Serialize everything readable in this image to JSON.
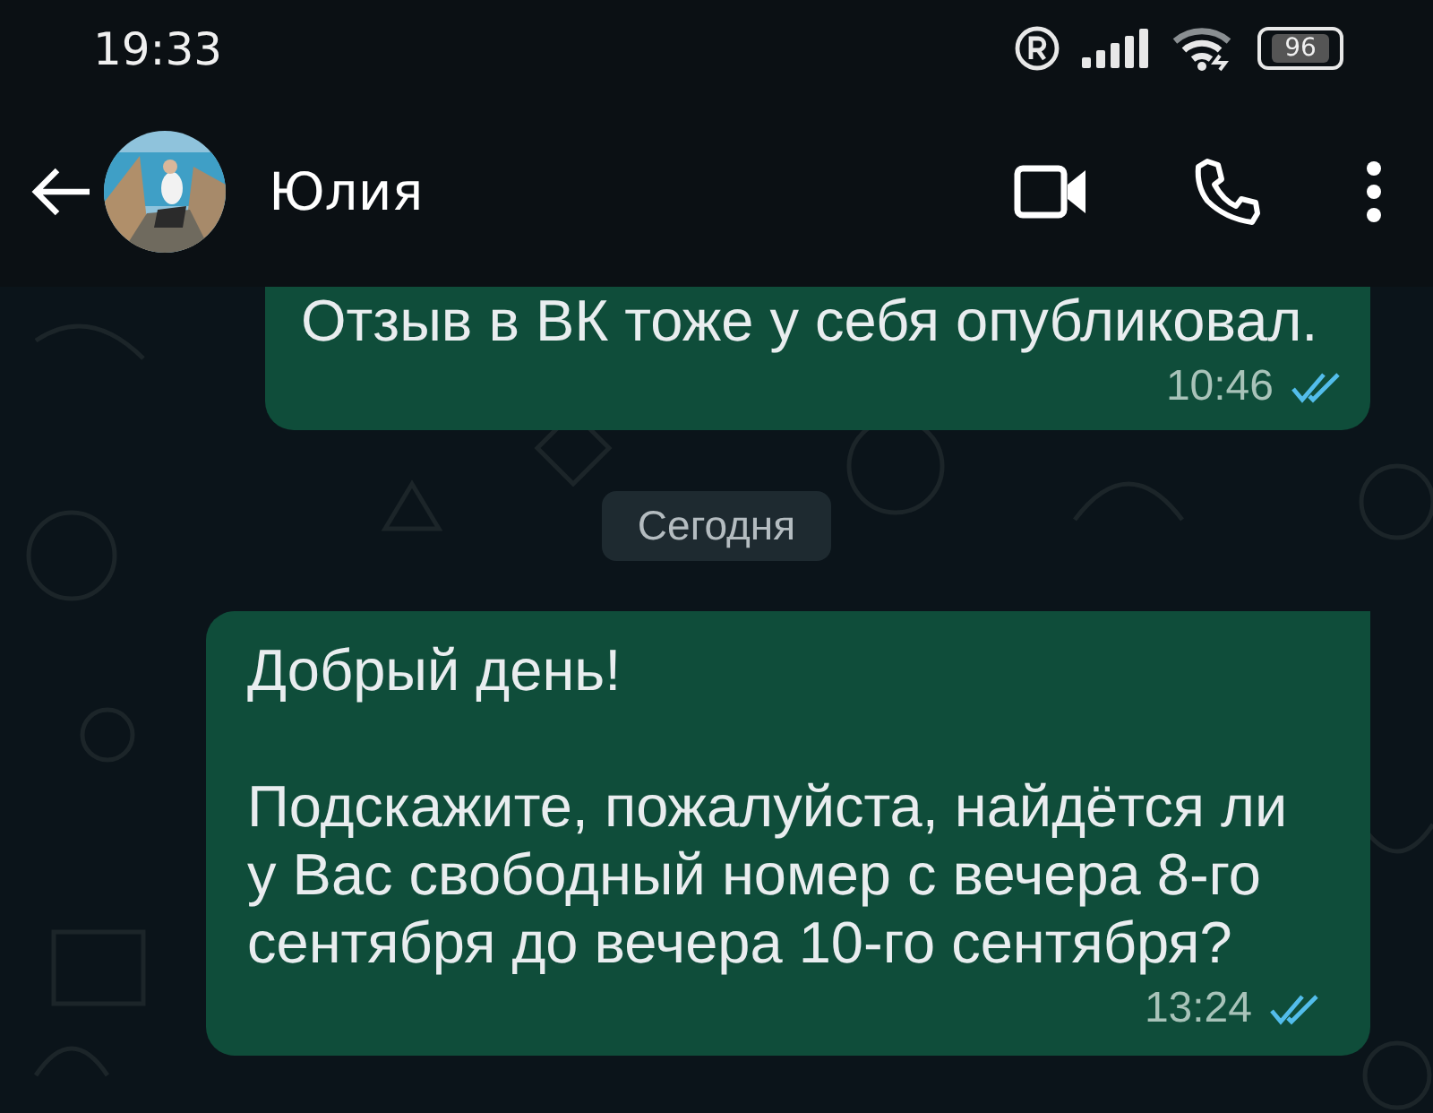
{
  "status_bar": {
    "time": "19:33",
    "battery": "96"
  },
  "header": {
    "contact_name": "Юлия"
  },
  "messages": [
    {
      "kind": "outgoing",
      "paragraphs": [
        "Отзыв в ВК тоже у себя опубликовал."
      ],
      "time": "10:46",
      "read": true,
      "cut_top": true
    },
    {
      "kind": "date",
      "label": "Сегодня"
    },
    {
      "kind": "outgoing",
      "paragraphs": [
        "Добрый день!",
        "Подскажите, пожалуйста, найдётся ли у Вас свободный номер с вечера 8-го сентября до вечера 10-го сентября?"
      ],
      "time": "13:24",
      "read": true,
      "cut_top": false
    }
  ]
}
